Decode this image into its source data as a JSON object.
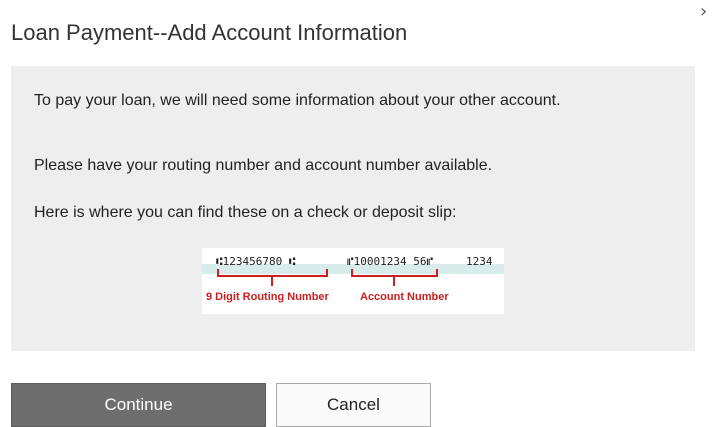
{
  "dialog": {
    "title": "Loan Payment--Add Account Information",
    "close_icon": "chevron-right-icon",
    "paragraphs": [
      "To pay your loan, we will need some information about your other account.",
      "Please have your routing number and account number available.",
      "Here is where you can find these on a check or deposit slip:"
    ]
  },
  "check_image": {
    "micr_routing": "⑆123456780 ⑆",
    "micr_account": "⑈10001234 56⑈",
    "micr_check": "1234",
    "routing_label": "9 Digit Routing Number",
    "account_label": "Account Number",
    "accent_color": "#cc1f1f"
  },
  "buttons": {
    "continue_label": "Continue",
    "cancel_label": "Cancel"
  },
  "colors": {
    "panel_bg": "#eeeeee",
    "continue_bg": "#6e6e6e"
  }
}
